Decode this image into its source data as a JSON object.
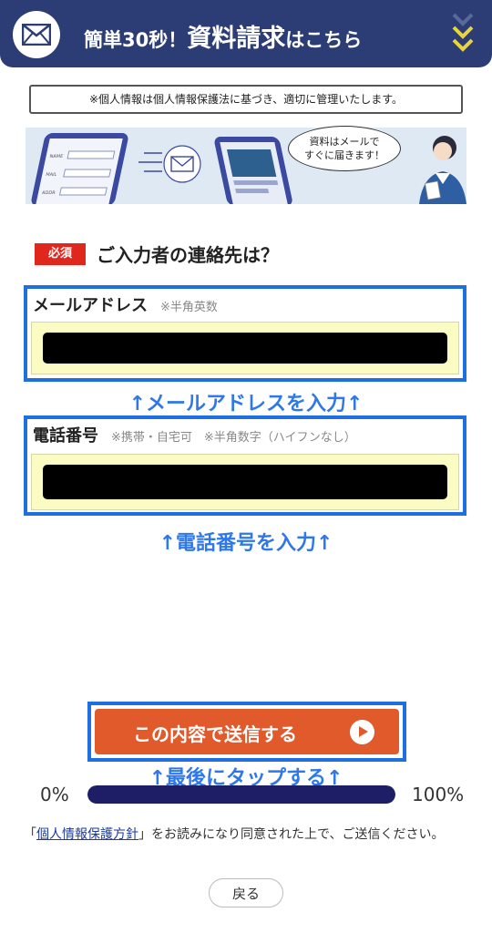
{
  "header": {
    "title_prefix": "簡単30秒！",
    "title_main": "資料請求",
    "title_suffix": "はこちら",
    "icons": [
      "mail-icon",
      "chevron-down-icon"
    ],
    "bar_color": "#2b3d74",
    "chevron_color": "#e7d53b"
  },
  "notice": "※個人情報は個人情報保護法に基づき、適切に管理いたします。",
  "banner": {
    "bubble_line1": "資料はメールで",
    "bubble_line2": "すぐに届きます！",
    "form_labels": [
      "NAME",
      "MAIL",
      "ADDR"
    ]
  },
  "question": {
    "required_label": "必須",
    "text": "ご入力者の連絡先は？"
  },
  "email_field": {
    "label": "メールアドレス",
    "note": "※半角英数",
    "value": ""
  },
  "phone_field": {
    "label": "電話番号",
    "note": "※携帯・自宅可　※半角数字（ハイフンなし）",
    "value": ""
  },
  "hints": {
    "email": "↑メールアドレスを入力↑",
    "phone": "↑電話番号を入力↑",
    "tap": "↑最後にタップする↑"
  },
  "submit_label": "この内容で送信する",
  "progress": {
    "start_label": "0%",
    "end_label": "100%",
    "value": 1.0
  },
  "consent": {
    "open_bracket": "「",
    "link_text": "個人情報保護方針",
    "rest": "」をお読みになり同意された上で、ご送信ください。"
  },
  "back_label": "戻る",
  "colors": {
    "accent_blue": "#1e6fe0",
    "required_red": "#e0271e",
    "submit_orange": "#e05a2c",
    "input_bg": "#fbfbc4",
    "progress_fill": "#1d1e66"
  }
}
